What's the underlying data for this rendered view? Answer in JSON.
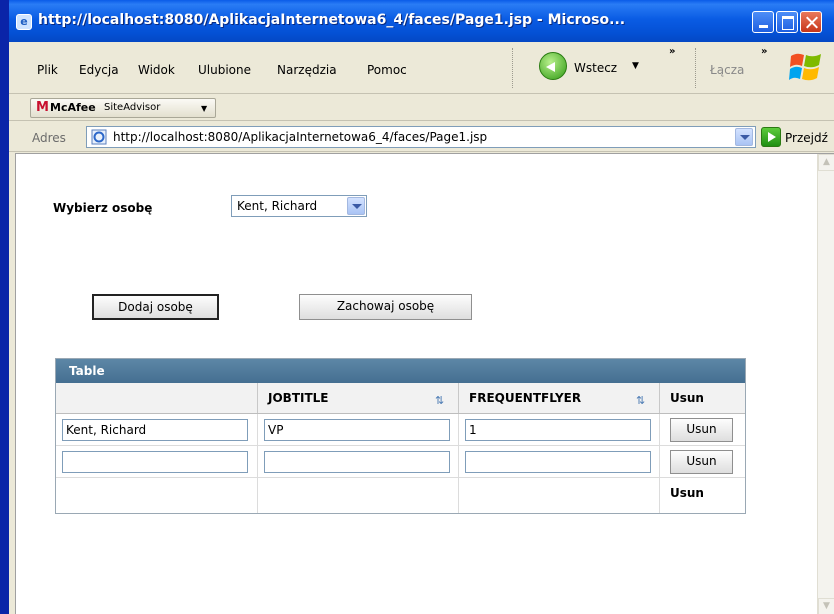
{
  "window": {
    "title": "http://localhost:8080/AplikacjaInternetowa6_4/faces/Page1.jsp - Microso..."
  },
  "menu": {
    "items": [
      "Plik",
      "Edycja",
      "Widok",
      "Ulubione",
      "Narzędzia",
      "Pomoc"
    ],
    "back_label": "Wstecz",
    "links_label": "Łącza"
  },
  "mcafee": {
    "brand": "McAfee",
    "product": "SiteAdvisor"
  },
  "address": {
    "label": "Adres",
    "url": "http://localhost:8080/AplikacjaInternetowa6_4/faces/Page1.jsp",
    "go_label": "Przejdź"
  },
  "page": {
    "select_label": "Wybierz osobę",
    "select_value": "Kent, Richard",
    "add_button": "Dodaj osobę",
    "save_button": "Zachowaj osobę"
  },
  "table": {
    "title": "Table",
    "headers": [
      "",
      "JOBTITLE",
      "FREQUENTFLYER",
      "Usun"
    ],
    "rows": [
      {
        "name": "Kent, Richard",
        "jobtitle": "VP",
        "frequentflyer": "1",
        "action": "Usun"
      },
      {
        "name": "",
        "jobtitle": "",
        "frequentflyer": "",
        "action": "Usun"
      }
    ],
    "footer_label": "Usun"
  },
  "colors": {
    "titlebar": "#0a5ce4",
    "table_header": "#5d87a6",
    "chrome": "#ece9d8"
  }
}
